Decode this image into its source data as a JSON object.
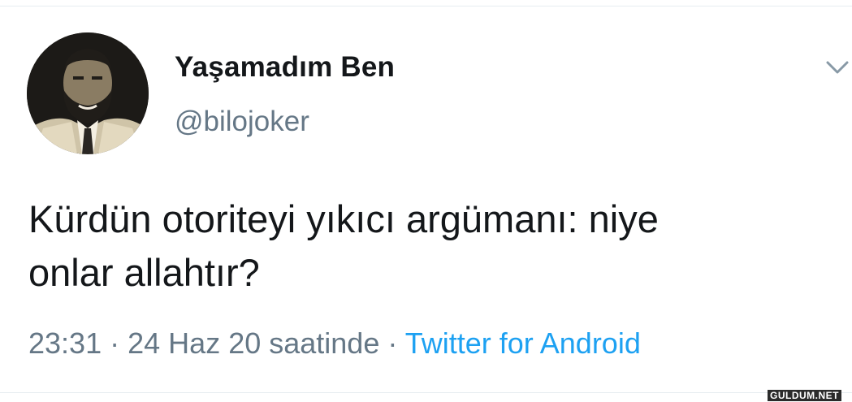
{
  "user": {
    "display_name": "Yaşamadım Ben",
    "handle": "@bilojoker",
    "avatar_icon": "profile-photo"
  },
  "tweet": {
    "text_lines": [
      "Kürdün otoriteyi yıkıcı argümanı: niye",
      "onlar allahtır?"
    ],
    "time": "23:31",
    "date": "24 Haz 20 saatinde",
    "separator": "·",
    "source": "Twitter for Android"
  },
  "menu_icon": "chevron-down-icon",
  "watermark": "GULDUM.NET",
  "colors": {
    "text": "#14171a",
    "secondary": "#657786",
    "link": "#1da1f2",
    "divider": "#e6ecf0"
  }
}
